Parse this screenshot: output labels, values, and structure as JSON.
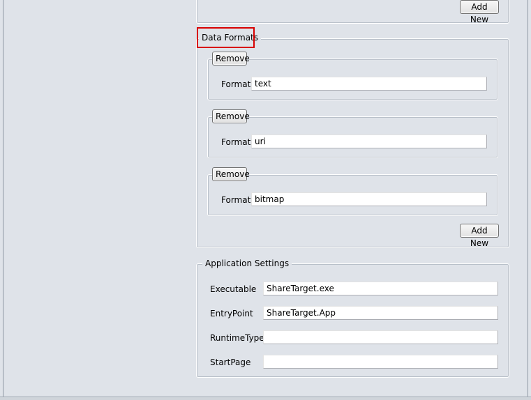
{
  "top_section": {
    "add_new_label": "Add New"
  },
  "data_formats": {
    "legend": "Data Formats",
    "items": [
      {
        "remove_label": "Remove",
        "field_label": "Format",
        "value": "text"
      },
      {
        "remove_label": "Remove",
        "field_label": "Format",
        "value": "uri"
      },
      {
        "remove_label": "Remove",
        "field_label": "Format",
        "value": "bitmap"
      }
    ],
    "add_new_label": "Add New"
  },
  "application_settings": {
    "legend": "Application Settings",
    "fields": [
      {
        "label": "Executable",
        "value": "ShareTarget.exe"
      },
      {
        "label": "EntryPoint",
        "value": "ShareTarget.App"
      },
      {
        "label": "RuntimeType",
        "value": ""
      },
      {
        "label": "StartPage",
        "value": ""
      }
    ]
  },
  "colors": {
    "background": "#dfe3e9",
    "highlight": "#d80000"
  }
}
